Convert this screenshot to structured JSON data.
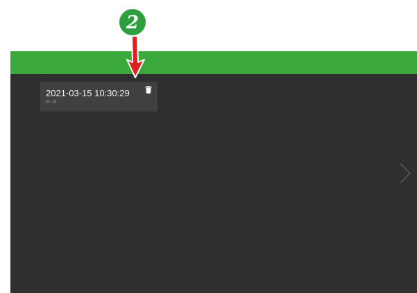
{
  "annotation": {
    "step_number": "2"
  },
  "record_card": {
    "title": "2021-03-15 10:30:29",
    "subtitle": "0 - 0"
  },
  "icons": {
    "delete": "trash-icon",
    "next": "chevron-right-icon",
    "pointer": "arrow-down-icon"
  },
  "colors": {
    "accent": "#3aa83a",
    "background": "#2f2f2f",
    "card": "#404040",
    "annotation_green": "#2e9e3e",
    "annotation_red": "#e02020"
  }
}
